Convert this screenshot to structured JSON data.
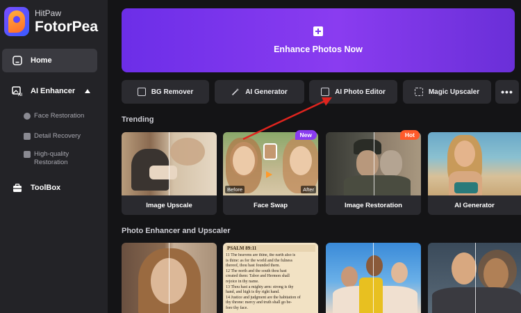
{
  "brand": {
    "small": "HitPaw",
    "big": "FotorPea"
  },
  "nav": {
    "home": "Home",
    "ai_enhancer": "AI Enhancer",
    "sub": [
      "Face Restoration",
      "Detail Recovery",
      "High-quality",
      "Restoration"
    ],
    "toolbox": "ToolBox"
  },
  "hero": {
    "label": "Enhance Photos Now"
  },
  "tools": [
    "BG Remover",
    "AI Generator",
    "AI Photo Editor",
    "Magic Upscaler"
  ],
  "more": "•••",
  "sections": {
    "trending": "Trending",
    "enhancer": "Photo Enhancer and Upscaler"
  },
  "trending": [
    {
      "label": "Image Upscale"
    },
    {
      "label": "Face Swap",
      "badge": "New",
      "before": "Before",
      "after": "After"
    },
    {
      "label": "Image Restoration",
      "badge": "Hot"
    },
    {
      "label": "AI Generator"
    }
  ],
  "book_text": {
    "heading": "PSALM 89:11",
    "lines": [
      "11 The heavens are thine, the earth also is",
      "is thine: as for the world and the fulness",
      "thereof, thou hast founded them.",
      "12 The north and the south thou hast",
      "created them: Tabor and Hermon shall",
      "rejoice in thy name.",
      "13 Thou hast a mighty arm: strong is thy",
      "hand, and high is thy right hand.",
      "14 Justice and judgment are the habitation of",
      "thy throne: mercy and truth shall go be-",
      "fore thy face."
    ]
  },
  "colors": {
    "accent": "#7a36ee",
    "sidebar": "#232327",
    "background": "#141416",
    "arrow": "#e0241e"
  }
}
